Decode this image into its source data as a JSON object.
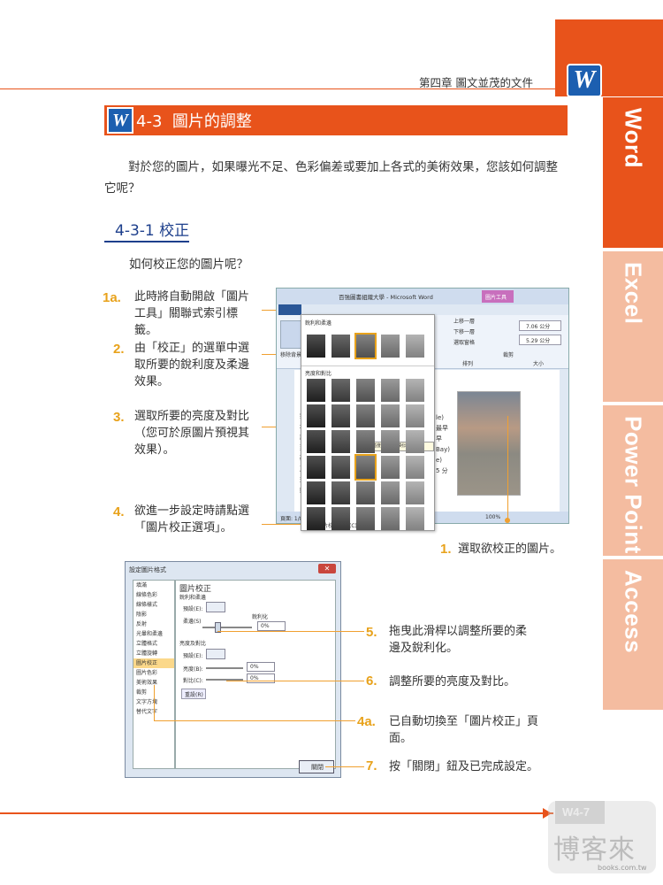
{
  "header": {
    "chapter": "第四章  圖文並茂的文件"
  },
  "tabs": [
    {
      "label": "Word",
      "color": "#e8531b"
    },
    {
      "label": "Excel",
      "color": "#f4bca0"
    },
    {
      "label": "Power Point",
      "color": "#f4bca0"
    },
    {
      "label": "Access",
      "color": "#f4bca0"
    }
  ],
  "section": {
    "number": "4-3",
    "title": "圖片的調整"
  },
  "intro": "對於您的圖片，如果曝光不足、色彩偏差或要加上各式的美術效果，您該如何調整它呢？",
  "subsection": {
    "title": "4-3-1 校正"
  },
  "question": "如何校正您的圖片呢？",
  "steps_left": [
    {
      "num": "1a.",
      "text": "此時將自動開啟「圖片工具」關聯式索引標籤。"
    },
    {
      "num": "2.",
      "text": "由「校正」的選單中選取所要的銳利度及柔邊效果。"
    },
    {
      "num": "3.",
      "text": "選取所要的亮度及對比（您可於原圖片預視其效果）。"
    },
    {
      "num": "4.",
      "text": "欲進一步設定時請點選「圖片校正選項」。"
    }
  ],
  "step1": {
    "num": "1.",
    "text": "選取欲校正的圖片。"
  },
  "steps_right": [
    {
      "num": "5.",
      "text": "拖曳此滑桿以調整所要的柔邊及銳利化。"
    },
    {
      "num": "6.",
      "text": "調整所要的亮度及對比。"
    },
    {
      "num": "4a.",
      "text": "已自動切換至「圖片校正」頁面。"
    },
    {
      "num": "7.",
      "text": "按「關閉」鈕及已完成設定。"
    }
  ],
  "word_window": {
    "title": "百強圖書組織大學 - Microsoft Word",
    "context_tab": "圖片工具",
    "tabs": [
      "檔案",
      "常用",
      "插入",
      "版面配置",
      "參考資料",
      "郵件",
      "校閱",
      "檢視",
      "格式"
    ],
    "remove_bg": "移除背景",
    "correction_btn": "校正",
    "sharpen_header": "銳利和柔邊",
    "bright_header": "亮度和對比",
    "tooltip": "亮度: +20% 對比: -20%",
    "options_link": "圖片校正選項(C)...",
    "arrange": [
      "上移一層",
      "下移一層",
      "選取窗格"
    ],
    "group_arrange": "排列",
    "group_size": "大小",
    "crop": "裁剪",
    "height": "7.06 公分",
    "width": "5.29 公分",
    "page": "頁面: 1/8",
    "zoom": "100%",
    "doc_text": [
      "笑",
      "地",
      "設",
      "到",
      "確",
      "及",
      "交",
      "鍵"
    ],
    "doc_right": [
      "le)",
      "最早",
      "早",
      "Bay)",
      "e)",
      "5 分"
    ]
  },
  "dialog": {
    "title": "設定圖片格式",
    "list": [
      "填滿",
      "線條色彩",
      "線條樣式",
      "陰影",
      "反射",
      "光暈和柔邊",
      "立體格式",
      "立體旋轉",
      "圖片校正",
      "圖片色彩",
      "美術效果",
      "裁剪",
      "文字方塊",
      "替代文字"
    ],
    "panel_title": "圖片校正",
    "sharpen": "銳利和柔邊",
    "preset1": "預設(E):",
    "soften": "柔邊(S)",
    "sharpen_lbl": "銳利化",
    "val1": "0%",
    "bright_group": "亮度及對比",
    "preset2": "預設(E):",
    "brightness": "亮度(B):",
    "val2": "0%",
    "contrast": "對比(C):",
    "val3": "0%",
    "reset": "重設(R)",
    "close": "關閉"
  },
  "footer": {
    "page": "W4-7"
  },
  "watermark": {
    "text": "博客來",
    "url": "books.com.tw"
  },
  "colors": {
    "accent": "#e8531b",
    "number": "#e8a21b",
    "heading_blue": "#1d3f8c"
  }
}
